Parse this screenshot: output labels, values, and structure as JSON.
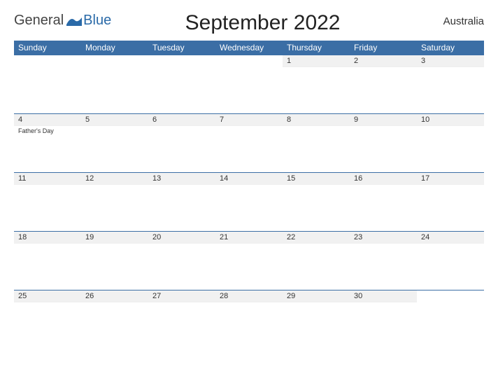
{
  "brand": {
    "part1": "General",
    "part2": "Blue"
  },
  "title": "September 2022",
  "country": "Australia",
  "dayNames": [
    "Sunday",
    "Monday",
    "Tuesday",
    "Wednesday",
    "Thursday",
    "Friday",
    "Saturday"
  ],
  "weeks": [
    [
      {
        "num": "",
        "event": ""
      },
      {
        "num": "",
        "event": ""
      },
      {
        "num": "",
        "event": ""
      },
      {
        "num": "",
        "event": ""
      },
      {
        "num": "1",
        "event": ""
      },
      {
        "num": "2",
        "event": ""
      },
      {
        "num": "3",
        "event": ""
      }
    ],
    [
      {
        "num": "4",
        "event": "Father's Day"
      },
      {
        "num": "5",
        "event": ""
      },
      {
        "num": "6",
        "event": ""
      },
      {
        "num": "7",
        "event": ""
      },
      {
        "num": "8",
        "event": ""
      },
      {
        "num": "9",
        "event": ""
      },
      {
        "num": "10",
        "event": ""
      }
    ],
    [
      {
        "num": "11",
        "event": ""
      },
      {
        "num": "12",
        "event": ""
      },
      {
        "num": "13",
        "event": ""
      },
      {
        "num": "14",
        "event": ""
      },
      {
        "num": "15",
        "event": ""
      },
      {
        "num": "16",
        "event": ""
      },
      {
        "num": "17",
        "event": ""
      }
    ],
    [
      {
        "num": "18",
        "event": ""
      },
      {
        "num": "19",
        "event": ""
      },
      {
        "num": "20",
        "event": ""
      },
      {
        "num": "21",
        "event": ""
      },
      {
        "num": "22",
        "event": ""
      },
      {
        "num": "23",
        "event": ""
      },
      {
        "num": "24",
        "event": ""
      }
    ],
    [
      {
        "num": "25",
        "event": ""
      },
      {
        "num": "26",
        "event": ""
      },
      {
        "num": "27",
        "event": ""
      },
      {
        "num": "28",
        "event": ""
      },
      {
        "num": "29",
        "event": ""
      },
      {
        "num": "30",
        "event": ""
      },
      {
        "num": "",
        "event": ""
      }
    ]
  ]
}
